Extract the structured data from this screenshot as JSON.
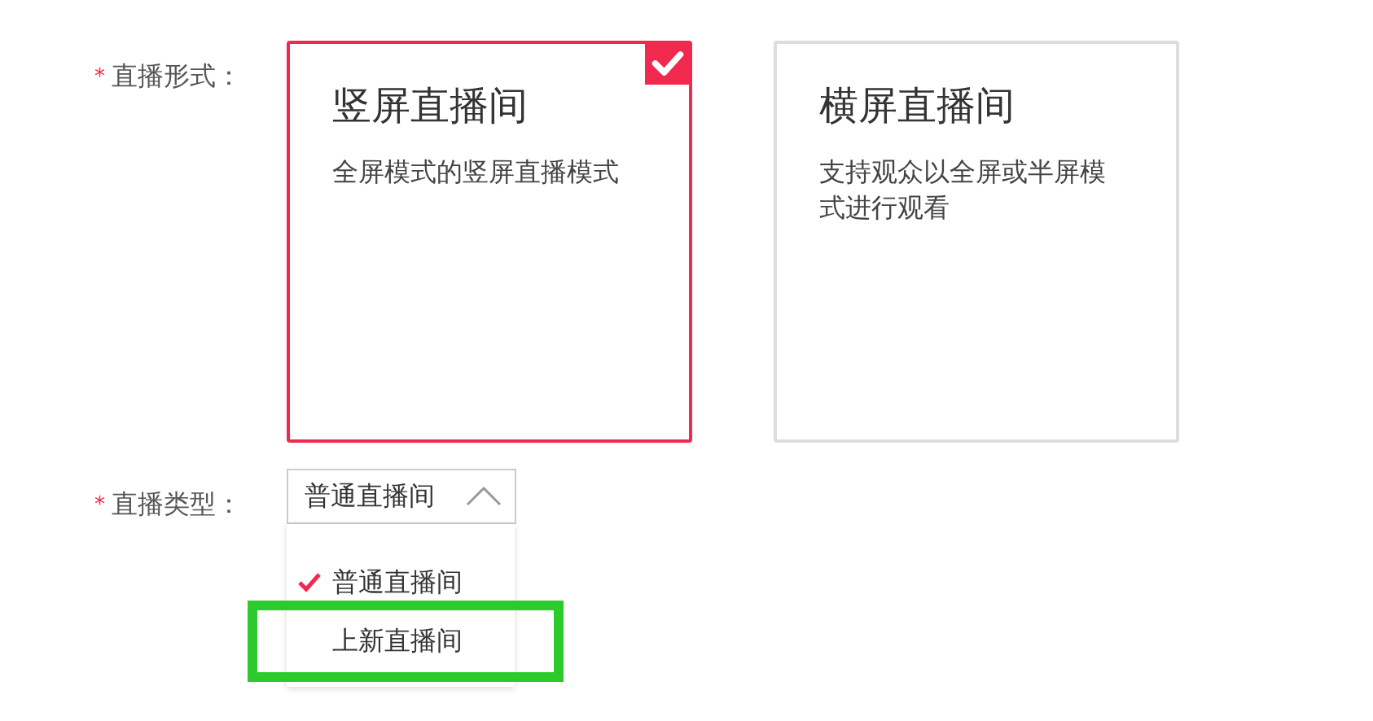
{
  "fields": [
    {
      "required_mark": "*",
      "label": "直播形式：",
      "kind": "cards",
      "options": [
        {
          "title": "竖屏直播间",
          "description": "全屏模式的竖屏直播模式",
          "selected": true
        },
        {
          "title": "横屏直播间",
          "description": "支持观众以全屏或半屏模式进行观看",
          "selected": false
        }
      ]
    },
    {
      "required_mark": "*",
      "label": "直播类型：",
      "kind": "select",
      "value": "普通直播间",
      "expanded": true,
      "options": [
        {
          "label": "普通直播间",
          "selected": true,
          "highlighted": false
        },
        {
          "label": "上新直播间",
          "selected": false,
          "highlighted": true
        }
      ]
    }
  ]
}
